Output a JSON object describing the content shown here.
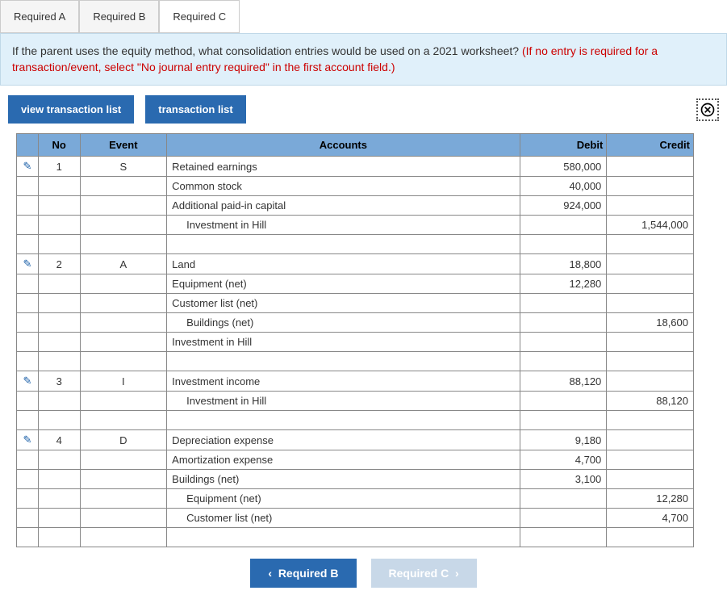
{
  "tabs": {
    "a": "Required A",
    "b": "Required B",
    "c": "Required C"
  },
  "instruction": {
    "main": "If the parent uses the equity method, what consolidation entries would be used on a 2021 worksheet? ",
    "red": "(If no entry is required for a transaction/event, select \"No journal entry required\" in the first account field.)"
  },
  "buttons": {
    "view_tx": "view transaction list",
    "tx_list": "transaction list"
  },
  "headers": {
    "no": "No",
    "event": "Event",
    "accounts": "Accounts",
    "debit": "Debit",
    "credit": "Credit"
  },
  "rows": [
    {
      "edit": true,
      "no": "1",
      "event": "S",
      "account": "Retained earnings",
      "indent": false,
      "debit": "580,000",
      "credit": ""
    },
    {
      "edit": false,
      "no": "",
      "event": "",
      "account": "Common stock",
      "indent": false,
      "debit": "40,000",
      "credit": ""
    },
    {
      "edit": false,
      "no": "",
      "event": "",
      "account": "Additional paid-in capital",
      "indent": false,
      "debit": "924,000",
      "credit": ""
    },
    {
      "edit": false,
      "no": "",
      "event": "",
      "account": "Investment in Hill",
      "indent": true,
      "debit": "",
      "credit": "1,544,000"
    },
    {
      "edit": false,
      "no": "",
      "event": "",
      "account": "",
      "indent": false,
      "debit": "",
      "credit": ""
    },
    {
      "edit": true,
      "no": "2",
      "event": "A",
      "account": "Land",
      "indent": false,
      "debit": "18,800",
      "credit": ""
    },
    {
      "edit": false,
      "no": "",
      "event": "",
      "account": "Equipment (net)",
      "indent": false,
      "debit": "12,280",
      "credit": ""
    },
    {
      "edit": false,
      "no": "",
      "event": "",
      "account": "Customer list (net)",
      "indent": false,
      "debit": "",
      "credit": ""
    },
    {
      "edit": false,
      "no": "",
      "event": "",
      "account": "Buildings (net)",
      "indent": true,
      "debit": "",
      "credit": "18,600"
    },
    {
      "edit": false,
      "no": "",
      "event": "",
      "account": "Investment in Hill",
      "indent": false,
      "debit": "",
      "credit": ""
    },
    {
      "edit": false,
      "no": "",
      "event": "",
      "account": "",
      "indent": false,
      "debit": "",
      "credit": ""
    },
    {
      "edit": true,
      "no": "3",
      "event": "I",
      "account": "Investment income",
      "indent": false,
      "debit": "88,120",
      "credit": ""
    },
    {
      "edit": false,
      "no": "",
      "event": "",
      "account": "Investment in Hill",
      "indent": true,
      "debit": "",
      "credit": "88,120"
    },
    {
      "edit": false,
      "no": "",
      "event": "",
      "account": "",
      "indent": false,
      "debit": "",
      "credit": ""
    },
    {
      "edit": true,
      "no": "4",
      "event": "D",
      "account": "Depreciation expense",
      "indent": false,
      "debit": "9,180",
      "credit": ""
    },
    {
      "edit": false,
      "no": "",
      "event": "",
      "account": "Amortization expense",
      "indent": false,
      "debit": "4,700",
      "credit": ""
    },
    {
      "edit": false,
      "no": "",
      "event": "",
      "account": "Buildings (net)",
      "indent": false,
      "debit": "3,100",
      "credit": ""
    },
    {
      "edit": false,
      "no": "",
      "event": "",
      "account": "Equipment (net)",
      "indent": true,
      "debit": "",
      "credit": "12,280"
    },
    {
      "edit": false,
      "no": "",
      "event": "",
      "account": "Customer list (net)",
      "indent": true,
      "debit": "",
      "credit": "4,700"
    },
    {
      "edit": false,
      "no": "",
      "event": "",
      "account": "",
      "indent": false,
      "debit": "",
      "credit": ""
    }
  ],
  "nav": {
    "prev": "Required B",
    "next": "Required C"
  }
}
